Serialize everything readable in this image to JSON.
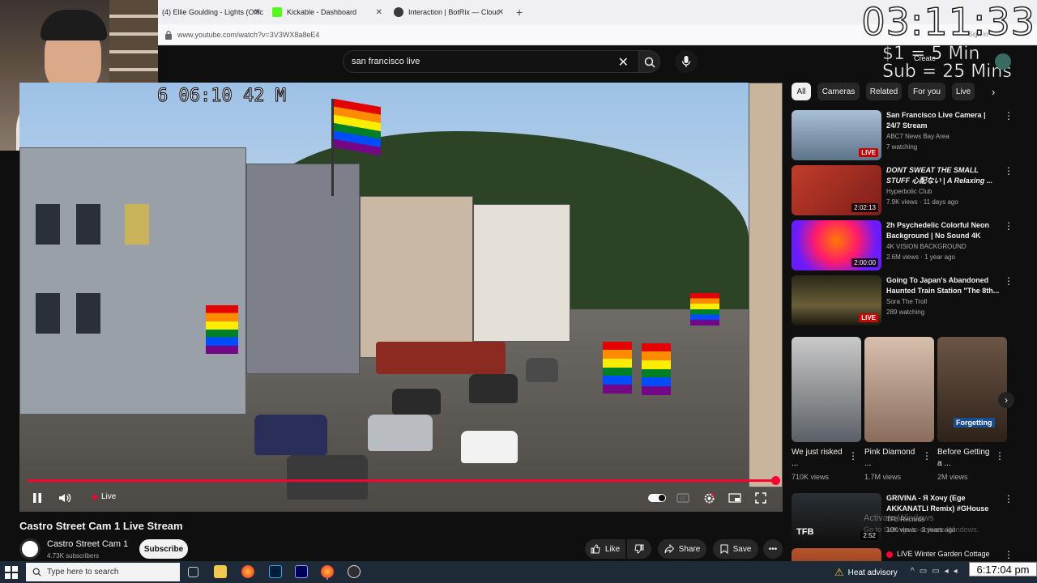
{
  "browser": {
    "tabs": [
      {
        "label": "(4) Ellie Goulding - Lights (Offic",
        "color": "#ff0033"
      },
      {
        "label": "Kickable - Dashboard",
        "color": "#53fc18"
      },
      {
        "label": "Interaction | BotRix — Cloud St",
        "color": "#3a3a3a"
      }
    ],
    "url": "www.youtube.com/watch?v=3V3WX8a8eE4",
    "sign_in": "Sign in"
  },
  "overlay": {
    "timer": "03:11:33",
    "rate_1": "$1 = 5 Min",
    "rate_2": "Sub = 25 Mins"
  },
  "header": {
    "search_value": "san francisco live",
    "create": "Create"
  },
  "video": {
    "camera_timestamp": "6 06:10 42  M",
    "live_label": "Live",
    "title": "Castro Street Cam 1 Live Stream",
    "channel": "Castro Street Cam 1",
    "subscribers": "4.73K subscribers",
    "subscribe": "Subscribe",
    "like": "Like",
    "share": "Share",
    "save": "Save"
  },
  "chips": [
    "All",
    "Cameras",
    "Related",
    "For you",
    "Live"
  ],
  "recommendations": [
    {
      "title": "San Francisco Live Camera | 24/7 Stream",
      "channel": "ABC7 News Bay Area",
      "meta": "7 watching",
      "badge": "LIVE",
      "live": true,
      "thumb": "#6f8aa3"
    },
    {
      "title": "DONT SWEAT THE SMALL STUFF 心配ない | A Relaxing ...",
      "channel": "Hyperbolic Club",
      "meta": "7.9K views · 11 days ago",
      "badge": "2:02:13",
      "live": false,
      "thumb": "#b23a2e"
    },
    {
      "title": "2h Psychedelic Colorful Neon Background | No Sound 4K",
      "channel": "4K VISION BACKGROUND",
      "meta": "2.6M views · 1 year ago",
      "badge": "2:00:00",
      "live": false,
      "thumb": "#d0208a"
    },
    {
      "title": "Going To Japan's Abandoned Haunted Train Station \"The 8th...",
      "channel": "Sora The Troll",
      "meta": "289 watching",
      "badge": "LIVE",
      "live": true,
      "thumb": "#3e3a2a"
    }
  ],
  "shorts": [
    {
      "title": "We just risked ...",
      "views": "710K views",
      "thumb": "#8c8f93"
    },
    {
      "title": "Pink Diamond ...",
      "views": "1.7M views",
      "thumb": "#b7a08e"
    },
    {
      "title": "Before Getting a ...",
      "views": "2M views",
      "thumb": "#5a4536",
      "caption": "Forgetting"
    }
  ],
  "recommendations_lower": [
    {
      "title": "GRIVINA - Я Хочу (Ege AKKANATLI Remix) #GHouse",
      "channel": "TFB Records",
      "meta": "10K views · 3 years ago",
      "badge": "2:52",
      "thumb": "#1c2126",
      "logo": "TFB"
    },
    {
      "title": "LIVE Winter Garden Cottage",
      "thumb": "#7a3d22"
    }
  ],
  "watermark": {
    "line1": "Activate Windows",
    "line2": "Go to Settings to activate Windows."
  },
  "taskbar": {
    "search_placeholder": "Type here to search",
    "weather": "Heat advisory",
    "clock": "6:17:04 pm"
  }
}
